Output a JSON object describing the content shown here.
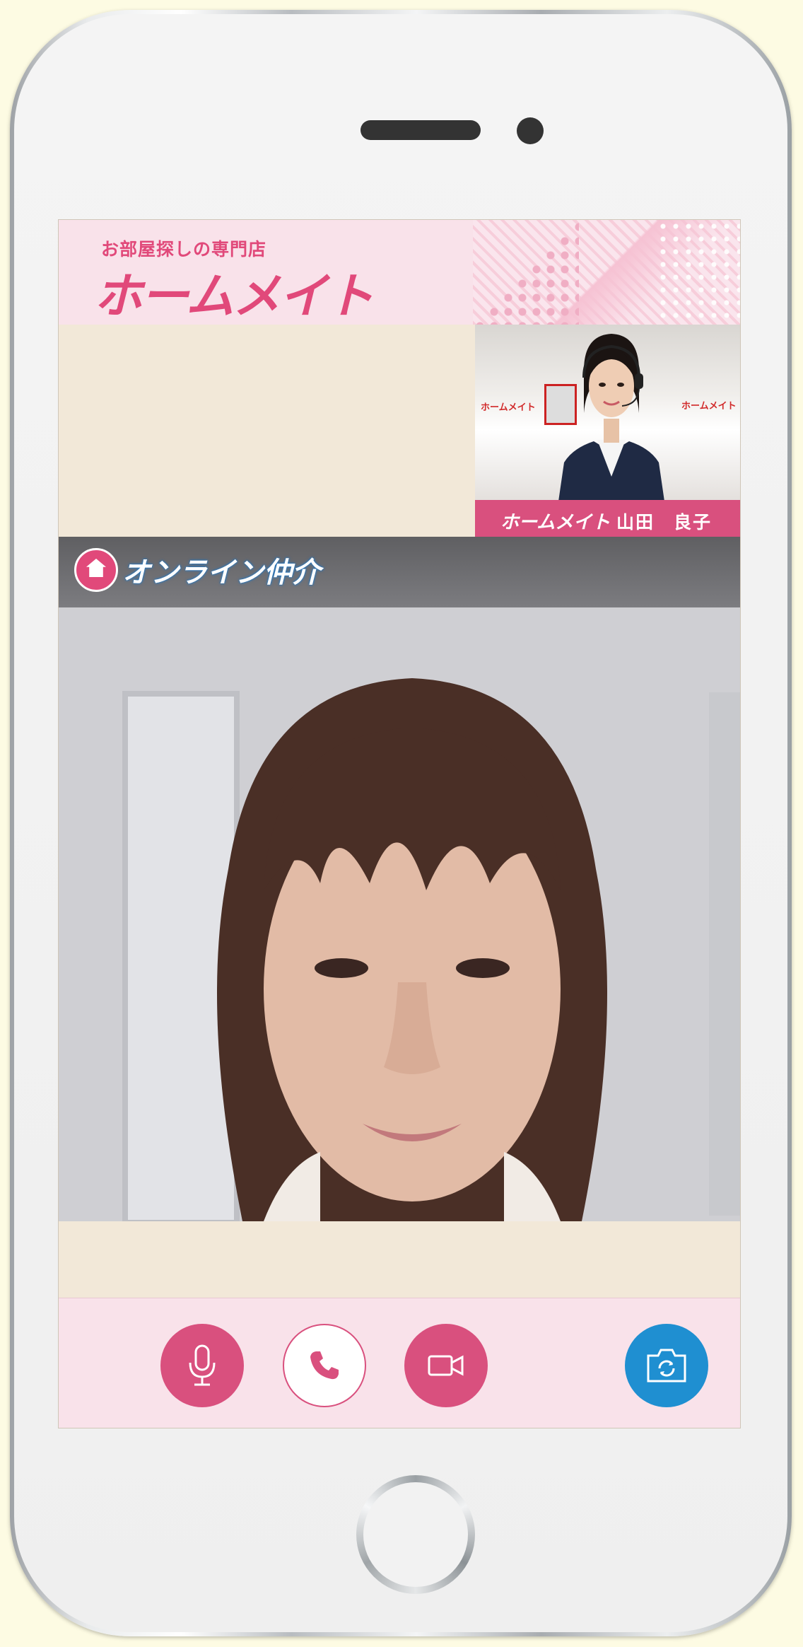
{
  "header": {
    "tagline": "お部屋探しの専門店",
    "logo": "ホームメイト"
  },
  "agent": {
    "brand": "ホームメイト",
    "name": "山田　良子",
    "office_sign": "ホームメイト"
  },
  "service": {
    "name": "オンライン仲介"
  },
  "controls": {
    "microphone": "mic-icon",
    "call": "phone-icon",
    "video": "video-camera-icon",
    "switch_camera": "camera-flip-icon"
  },
  "colors": {
    "brand_pink": "#d9507e",
    "header_bg": "#f9e2ea",
    "accent_blue": "#1f8fd1",
    "screen_beige": "#f2e8d8"
  }
}
